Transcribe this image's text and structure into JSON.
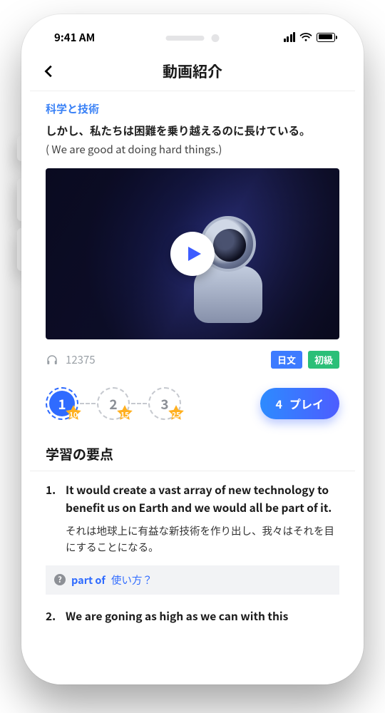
{
  "status": {
    "time": "9:41 AM"
  },
  "header": {
    "title": "動画紹介"
  },
  "meta": {
    "category": "科学と技術",
    "sentence_ja": "しかし、私たちは困難を乗り越えるのに長けている。",
    "sentence_en": "( We are good at doing hard things.)"
  },
  "stats": {
    "listens": "12375",
    "tag_lang": "日文",
    "tag_level": "初級"
  },
  "steps": {
    "items": [
      {
        "n": "1",
        "star": "10",
        "state": "done"
      },
      {
        "n": "2",
        "star": "15",
        "state": "pending"
      },
      {
        "n": "3",
        "star": "25",
        "state": "pending"
      }
    ],
    "play_n": "4",
    "play_label": "プレイ"
  },
  "section_title": "学習の要点",
  "points": [
    {
      "num": "1.",
      "en": "It would create a vast array of new technology to benefit us on Earth and we would all be part of it.",
      "ja": "それは地球上に有益な新技術を作り出し、我々はそれを目にすることになる。"
    },
    {
      "num": "2.",
      "en": "We are goning as high as we can with this"
    }
  ],
  "hint": {
    "phrase": "part of",
    "tail": "使い方？"
  },
  "icons": {
    "back": "chevron-left",
    "play": "play",
    "headphones": "headphones",
    "question": "?"
  },
  "colors": {
    "accent_blue": "#3d5cff",
    "link_blue": "#2f6bff",
    "tag_lang": "#3d7bff",
    "tag_level": "#2bbf78",
    "star": "#ffb020"
  }
}
